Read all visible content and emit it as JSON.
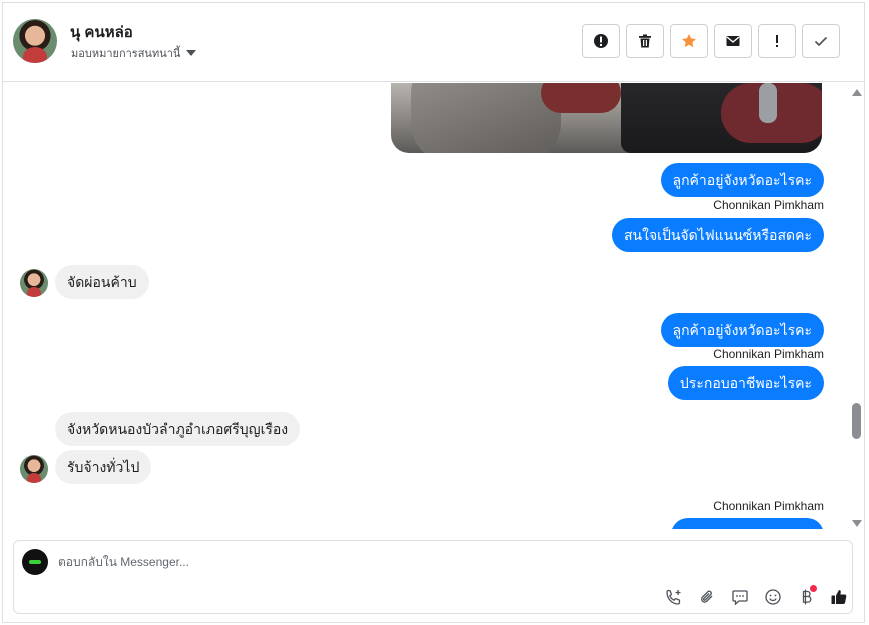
{
  "header": {
    "contact_name": "นุ คนหล่อ",
    "assign_label": "มอบหมายการสนทนานี้",
    "actions": [
      {
        "icon": "alert-circle-icon",
        "glyph": "!"
      },
      {
        "icon": "trash-icon",
        "glyph": "🗑"
      },
      {
        "icon": "star-icon",
        "glyph": "★"
      },
      {
        "icon": "envelope-icon",
        "glyph": "✉"
      },
      {
        "icon": "exclamation-icon",
        "glyph": "!"
      },
      {
        "icon": "checkmark-icon",
        "glyph": "✓"
      }
    ]
  },
  "messages": [
    {
      "type": "outgoing",
      "text": "ลูกค้าอยู่จังหวัดอะไรคะ"
    },
    {
      "type": "sender",
      "text": "Chonnikan Pimkham"
    },
    {
      "type": "outgoing",
      "text": "สนใจเป็นจัดไฟแนนซ์หรือสดคะ"
    },
    {
      "type": "incoming",
      "text": "จัดผ่อนค้าบ"
    },
    {
      "type": "outgoing",
      "text": "ลูกค้าอยู่จังหวัดอะไรคะ"
    },
    {
      "type": "sender",
      "text": "Chonnikan Pimkham"
    },
    {
      "type": "outgoing",
      "text": "ประกอบอาชีพอะไรคะ"
    },
    {
      "type": "incoming",
      "text": "จังหวัดหนองบัวลำภูอำเภอศรีบุญเรือง"
    },
    {
      "type": "incoming",
      "text": "รับจ้างทั่วไป"
    },
    {
      "type": "sender",
      "text": "Chonnikan Pimkham"
    }
  ],
  "composer": {
    "placeholder": "ตอบกลับใน Messenger..."
  },
  "colors": {
    "outgoing_bubble": "#0a7cff",
    "incoming_bubble": "#f1f0f0",
    "star_accent": "#f7923a",
    "notification_dot": "#f02849"
  }
}
